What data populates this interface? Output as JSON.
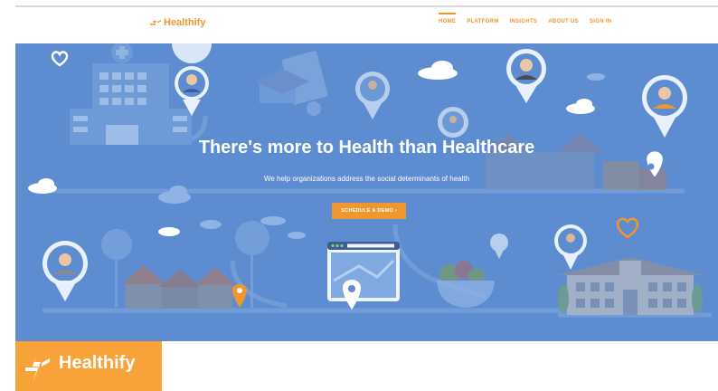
{
  "brand": {
    "name": "Healthify",
    "accent_color": "#f0962e",
    "tile_color": "#f7a33a"
  },
  "nav": {
    "items": [
      {
        "label": "HOME",
        "active": true
      },
      {
        "label": "PLATFORM",
        "active": false
      },
      {
        "label": "INSIGHTS",
        "active": false
      },
      {
        "label": "ABOUT US",
        "active": false
      },
      {
        "label": "SIGN IN",
        "active": false
      }
    ]
  },
  "hero": {
    "title": "There's more to Health than Healthcare",
    "subtitle": "We help organizations address the social determinants of health",
    "cta_label": "SCHEDULE A DEMO ›",
    "background_color": "#5d8dd0",
    "icons": [
      "heart-icon",
      "hospital-icon",
      "person-pin-icon",
      "diploma-icon",
      "cloud-icon",
      "map-pin-icon",
      "browser-map-icon",
      "house-icon",
      "salad-bowl-icon",
      "building-icon"
    ]
  }
}
